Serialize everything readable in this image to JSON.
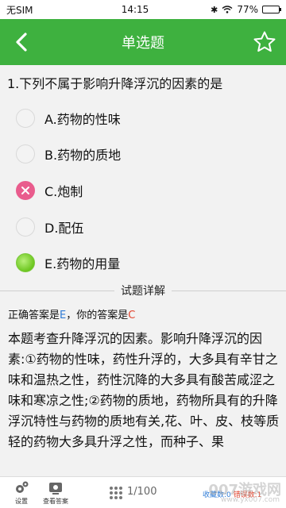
{
  "status": {
    "carrier": "无SIM",
    "time": "14:15",
    "battery_text": "77%",
    "battery_level": 0.77
  },
  "header": {
    "title": "单选题"
  },
  "question": {
    "text": "1.下列不属于影响升降浮沉的因素的是",
    "options": [
      {
        "label": "A.药物的性味",
        "state": "none"
      },
      {
        "label": "B.药物的质地",
        "state": "none"
      },
      {
        "label": "C.炮制",
        "state": "wrong"
      },
      {
        "label": "D.配伍",
        "state": "none"
      },
      {
        "label": "E.药物的用量",
        "state": "correct"
      }
    ]
  },
  "detail": {
    "section_title": "试题详解",
    "correct_prefix": "正确答案是",
    "correct_answer": "E",
    "user_prefix": "，你的答案是",
    "user_answer": "C",
    "explanation": "本题考查升降浮沉的因素。影响升降浮沉的因素:①药物的性味，药性升浮的，大多具有辛甘之味和温热之性，药性沉降的大多具有酸苦咸涩之味和寒凉之性;②药物的质地，药物所具有的升降浮沉特性与药物的质地有关,花、叶、皮、枝等质轻的药物大多具升浮之性，而种子、果"
  },
  "bottom": {
    "settings_label": "设置",
    "answer_label": "查看答案",
    "page": "1/100",
    "stats_text": "收藏数:0",
    "wrong_text": "错误数:1",
    "watermark": "007游戏网",
    "watermark_sub": "www.yx007.com"
  },
  "colors": {
    "header": "#3eb13f",
    "wrong": "#e95c8d",
    "correct": "#6cc61f",
    "correct_answer_text": "#2e7bd6",
    "user_answer_text": "#e2452f"
  }
}
